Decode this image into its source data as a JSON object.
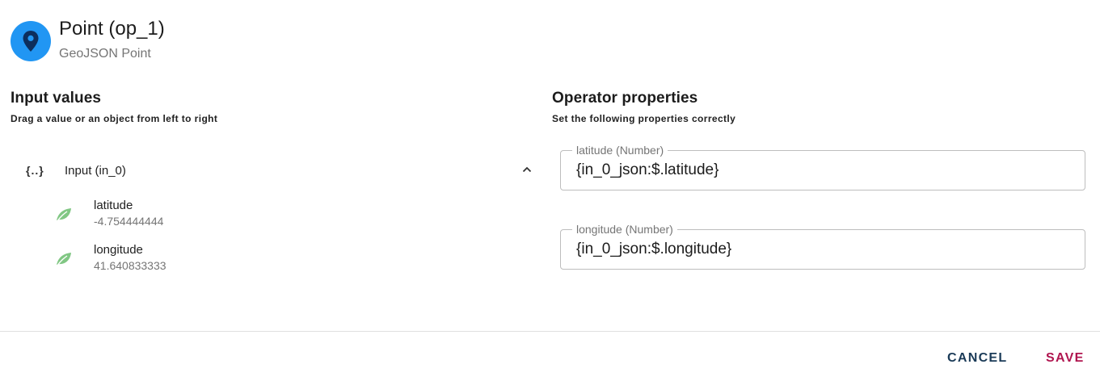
{
  "header": {
    "title": "Point (op_1)",
    "subtitle": "GeoJSON Point",
    "icon": "location-pin-icon",
    "accent": "#2196f3"
  },
  "input_values": {
    "heading": "Input values",
    "subheading": "Drag a value or an object from left to right",
    "input": {
      "icon_text": "{..}",
      "label": "Input (in_0)",
      "expanded": true
    },
    "items": [
      {
        "name": "latitude",
        "value": "-4.754444444",
        "icon": "leaf-icon"
      },
      {
        "name": "longitude",
        "value": "41.640833333",
        "icon": "leaf-icon"
      }
    ]
  },
  "operator_properties": {
    "heading": "Operator properties",
    "subheading": "Set the following properties correctly",
    "fields": [
      {
        "label": "latitude (Number)",
        "value": "{in_0_json:$.latitude}"
      },
      {
        "label": "longitude (Number)",
        "value": "{in_0_json:$.longitude}"
      }
    ]
  },
  "actions": {
    "cancel": "CANCEL",
    "save": "SAVE",
    "cancel_color": "#1a3a57",
    "save_color": "#b0154f"
  }
}
